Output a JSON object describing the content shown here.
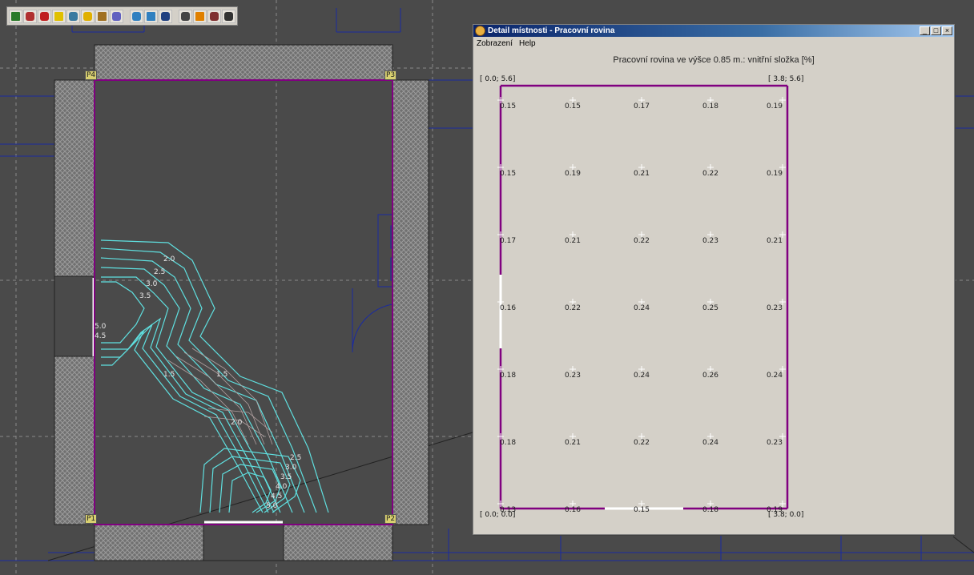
{
  "toolbar": {
    "buttons": [
      "view-3d-icon",
      "room-icon",
      "wall-icon",
      "door-icon",
      "window-icon",
      "light-icon",
      "house-icon",
      "roof-icon",
      "grid-icon",
      "measure-icon",
      "calc-icon",
      "line-icon",
      "sun-icon",
      "report-icon",
      "pen-icon"
    ]
  },
  "cad": {
    "corners": {
      "p1": "P1",
      "p2": "P2",
      "p3": "P3",
      "p4": "P4"
    },
    "contour_labels": [
      "2.0",
      "2.5",
      "3.0",
      "3.5",
      "1.5",
      "1.5",
      "2.0",
      "2.5",
      "3.0",
      "3.5",
      "4.0",
      "4.5",
      "5.0",
      "5.0",
      "4.5"
    ]
  },
  "dialog": {
    "title": "Detail místnosti - Pracovní rovina",
    "buttons": {
      "minimize": "_",
      "maximize": "□",
      "close": "×"
    },
    "menu": [
      "Zobrazení",
      "Help"
    ],
    "heading": "Pracovní rovina ve výšce  0.85 m.: vnitřní složka [%]",
    "corner_labels": {
      "top_left": "[ 0.0; 5.6]",
      "top_right": "[ 3.8; 5.6]",
      "bottom_left": "[ 0.0; 0.0]",
      "bottom_right": "[ 3.8; 0.0]"
    },
    "grid_values": [
      [
        "0.15",
        "0.15",
        "0.17",
        "0.18",
        "0.19"
      ],
      [
        "0.15",
        "0.19",
        "0.21",
        "0.22",
        "0.19"
      ],
      [
        "0.17",
        "0.21",
        "0.22",
        "0.23",
        "0.21"
      ],
      [
        "0.16",
        "0.22",
        "0.24",
        "0.25",
        "0.23"
      ],
      [
        "0.18",
        "0.23",
        "0.24",
        "0.26",
        "0.24"
      ],
      [
        "0.18",
        "0.21",
        "0.22",
        "0.24",
        "0.23"
      ],
      [
        "0.13",
        "0.16",
        "0.15",
        "0.18",
        "0.19"
      ]
    ],
    "colors": {
      "wall": "#800080",
      "opening": "#ffffff",
      "marker": "#ffffff"
    }
  },
  "colors": {
    "background": "#4a4a4a",
    "room_outline": "#800080",
    "contour": "#5fe0e0",
    "grid_line": "#8a8a8a",
    "cad_line": "#1a2aa0"
  }
}
